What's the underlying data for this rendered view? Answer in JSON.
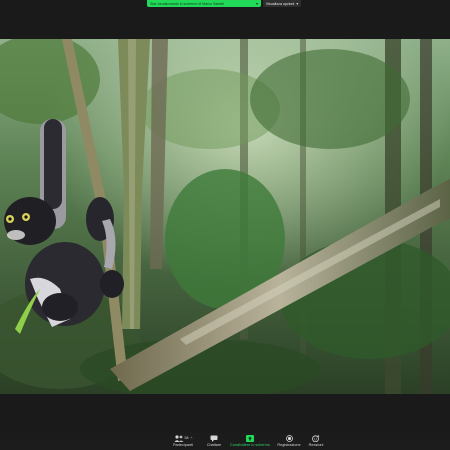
{
  "share_banner": {
    "text": "Stai visualizzando lo schermo di Marco Sabelli",
    "options_label": "Visualizza opzioni"
  },
  "toolbar": {
    "participants": {
      "label": "Partecipanti",
      "count": "58"
    },
    "chat": {
      "label": "Chattare"
    },
    "share": {
      "label": "Condividere lo schermo"
    },
    "record": {
      "label": "Registrazione"
    },
    "reactions": {
      "label": "Reazioni"
    }
  },
  "colors": {
    "accent_green": "#23d959",
    "toolbar_bg": "#1c1c1c",
    "app_bg": "#1a1a1a"
  },
  "icons": [
    "participants-icon",
    "chat-icon",
    "share-screen-icon",
    "record-icon",
    "reactions-icon",
    "chevron-down-icon"
  ]
}
